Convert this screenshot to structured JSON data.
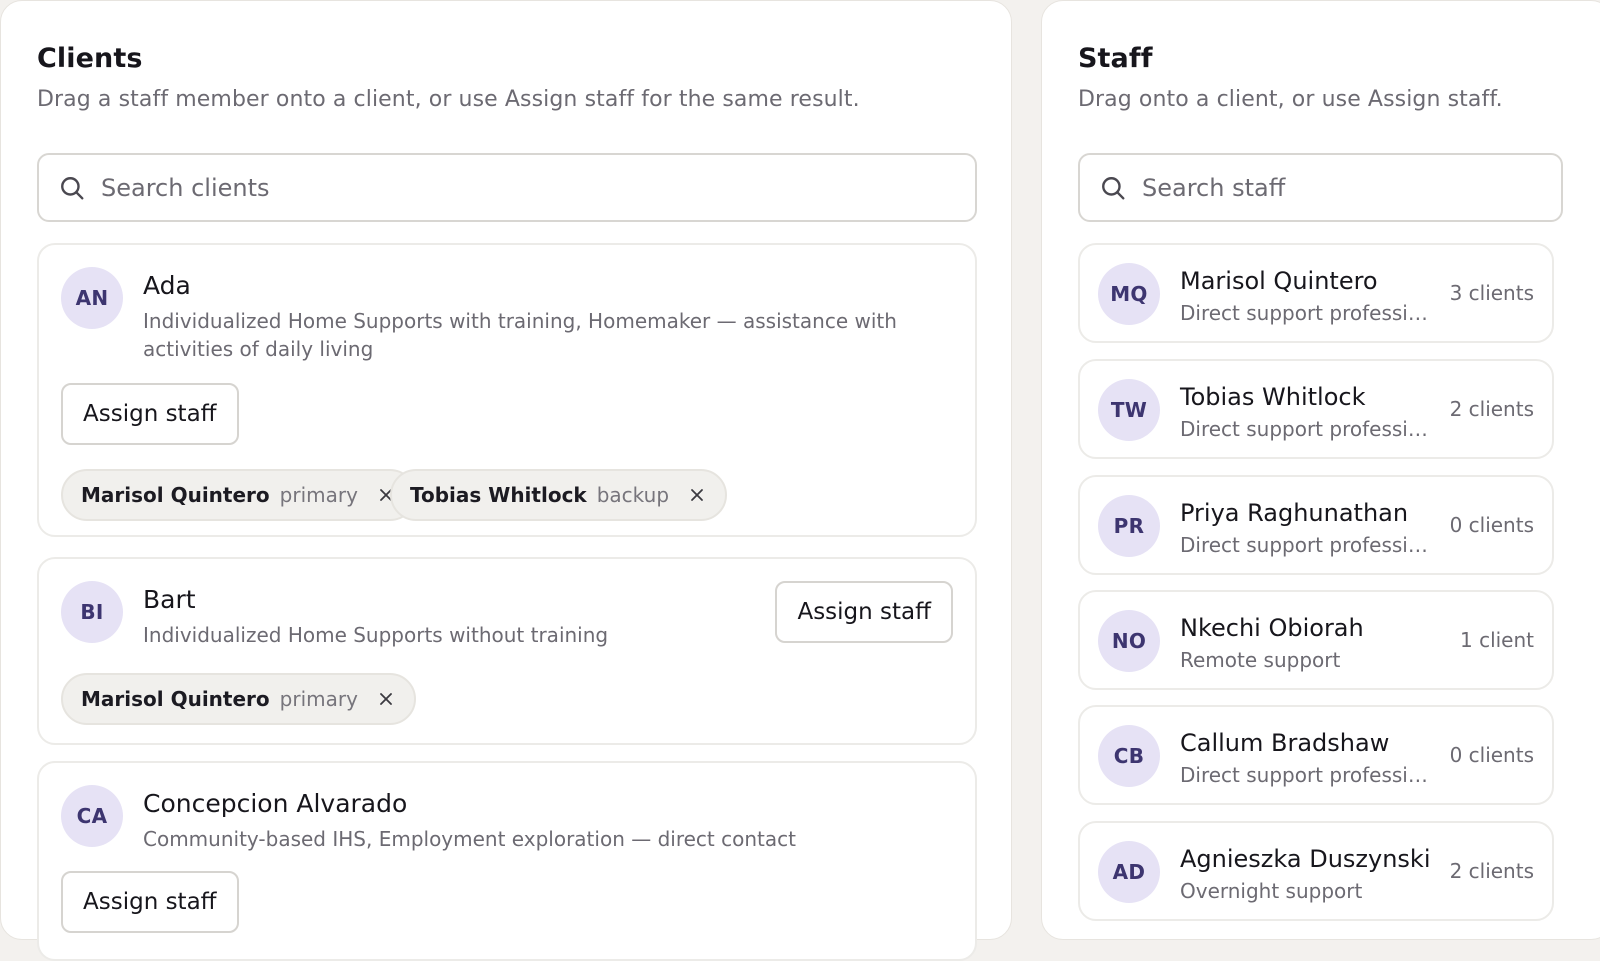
{
  "clients_panel": {
    "title": "Clients",
    "subtitle": "Drag a staff member onto a client, or use Assign staff for the same result.",
    "search_placeholder": "Search clients",
    "items": [
      {
        "initials": "AN",
        "name": "Ada",
        "description": "Individualized Home Supports with training, Homemaker — assistance with activities of daily living",
        "assign_label": "Assign staff",
        "assignments": [
          {
            "name": "Marisol Quintero",
            "role": "primary"
          },
          {
            "name": "Tobias Whitlock",
            "role": "backup"
          }
        ]
      },
      {
        "initials": "BI",
        "name": "Bart",
        "description": "Individualized Home Supports without training",
        "assign_label": "Assign staff",
        "assignments": [
          {
            "name": "Marisol Quintero",
            "role": "primary"
          }
        ]
      },
      {
        "initials": "CA",
        "name": "Concepcion Alvarado",
        "description": "Community-based IHS, Employment exploration — direct contact",
        "assign_label": "Assign staff",
        "assignments": []
      }
    ]
  },
  "staff_panel": {
    "title": "Staff",
    "subtitle": "Drag onto a client, or use Assign staff.",
    "search_placeholder": "Search staff",
    "items": [
      {
        "initials": "MQ",
        "name": "Marisol Quintero",
        "role": "Direct support profession...",
        "count": "3 clients"
      },
      {
        "initials": "TW",
        "name": "Tobias Whitlock",
        "role": "Direct support profession...",
        "count": "2 clients"
      },
      {
        "initials": "PR",
        "name": "Priya Raghunathan",
        "role": "Direct support profession...",
        "count": "0 clients"
      },
      {
        "initials": "NO",
        "name": "Nkechi Obiorah",
        "role": "Remote support",
        "count": "1 client"
      },
      {
        "initials": "CB",
        "name": "Callum Bradshaw",
        "role": "Direct support profession...",
        "count": "0 clients"
      },
      {
        "initials": "AD",
        "name": "Agnieszka Duszynski",
        "role": "Overnight support",
        "count": "2 clients"
      }
    ]
  },
  "icons": {
    "search": "search-icon",
    "remove": "close-icon"
  },
  "colors": {
    "avatar_bg": "#e6e2f5",
    "avatar_text": "#3d3570",
    "chip_bg": "#f1f0ed",
    "page_bg": "#f3f1ee"
  }
}
